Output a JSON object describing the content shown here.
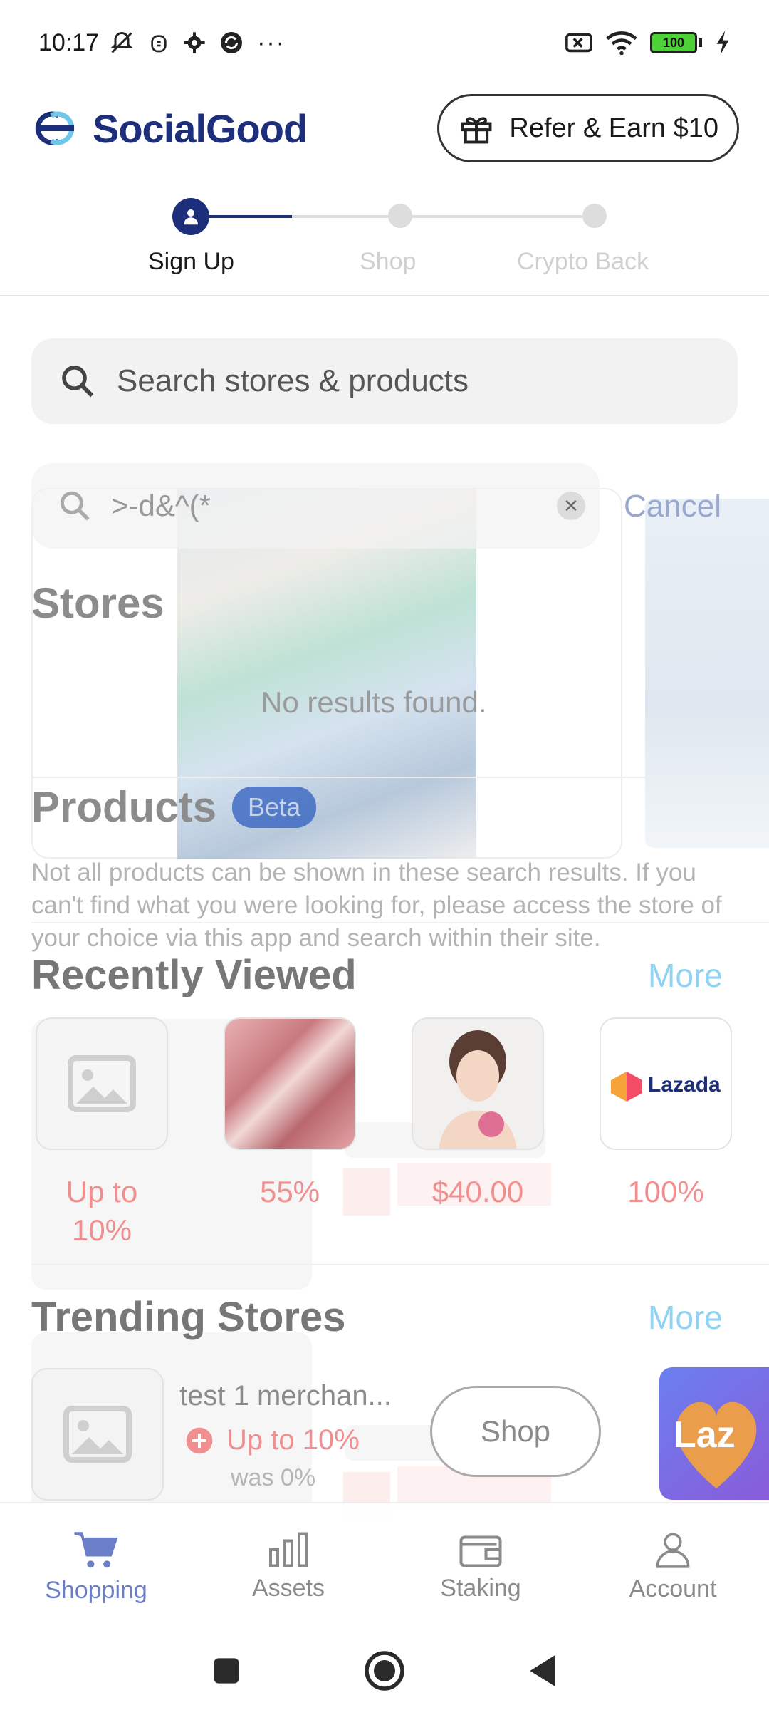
{
  "status_bar": {
    "time": "10:17",
    "battery": "100"
  },
  "header": {
    "brand": "SocialGood",
    "refer_label": "Refer & Earn $10"
  },
  "stepper": {
    "steps": [
      {
        "label": "Sign Up",
        "active": true
      },
      {
        "label": "Shop",
        "active": false
      },
      {
        "label": "Crypto Back",
        "active": false
      }
    ]
  },
  "search": {
    "placeholder": "Search stores & products"
  },
  "overlay": {
    "query": ">-d&^(*",
    "cancel": "Cancel",
    "stores_title": "Stores",
    "no_results": "No results found.",
    "products_title": "Products",
    "beta": "Beta",
    "note": "Not all products can be shown in these search results. If you can't find what you were looking for, please access the store of your choice via this app and search within their site."
  },
  "recently_viewed": {
    "title": "Recently Viewed",
    "more": "More",
    "items": [
      {
        "label": "Up to 10%",
        "thumb": "placeholder-image-icon"
      },
      {
        "label": "55%",
        "thumb": "lipstick-photo"
      },
      {
        "label": "$40.00",
        "thumb": "portrait-photo"
      },
      {
        "label": "100%",
        "thumb": "lazada-logo",
        "logo_text": "Lazada"
      }
    ]
  },
  "trending_stores": {
    "title": "Trending Stores",
    "more": "More",
    "items": [
      {
        "name": "test 1 merchan...",
        "cashback": "Up to 10%",
        "was": "was 0%",
        "button": "Shop"
      }
    ],
    "partial_card_text": "Laz"
  },
  "bottom_nav": {
    "items": [
      {
        "label": "Shopping",
        "icon": "cart-icon",
        "active": true
      },
      {
        "label": "Assets",
        "icon": "bar-chart-icon",
        "active": false
      },
      {
        "label": "Staking",
        "icon": "wallet-icon",
        "active": false
      },
      {
        "label": "Account",
        "icon": "person-icon",
        "active": false
      }
    ]
  },
  "colors": {
    "brand_navy": "#1d2f7a",
    "cashback_red": "#f08f8f",
    "more_blue": "#8fd2f2",
    "nav_active": "#6b7fc8"
  }
}
